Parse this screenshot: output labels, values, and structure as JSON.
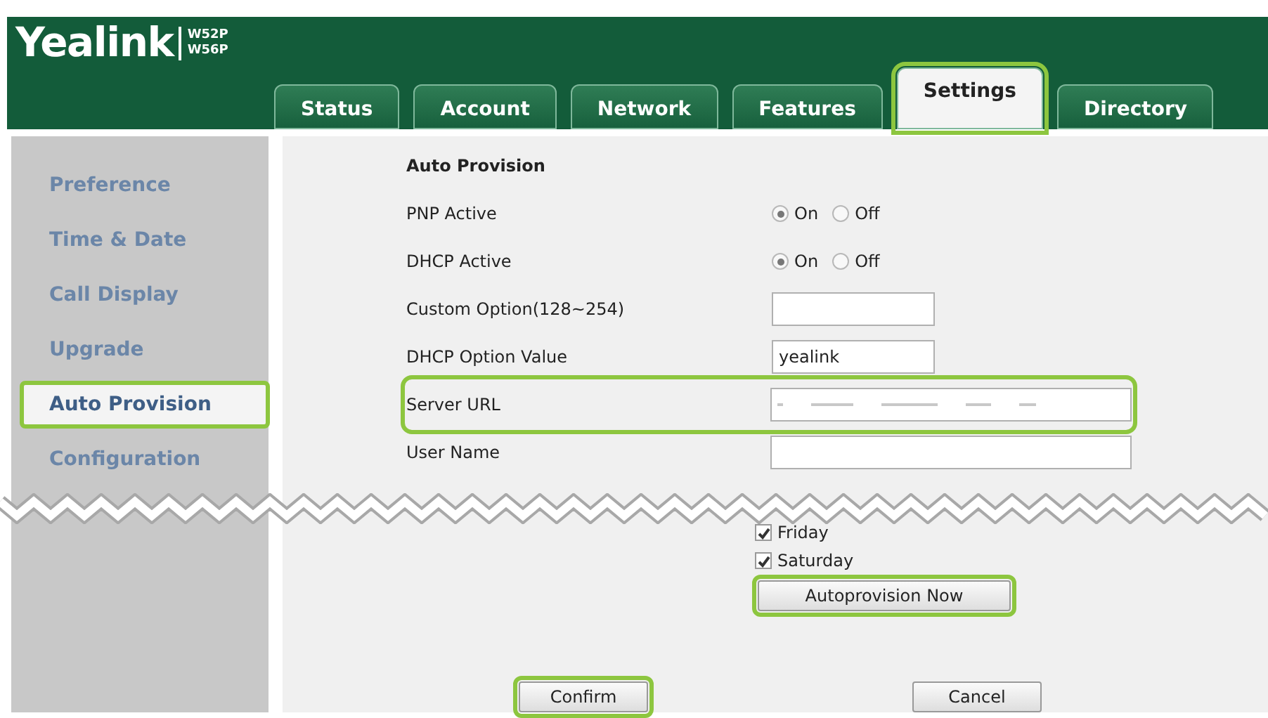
{
  "logo": {
    "brand": "Yealink",
    "models": [
      "W52P",
      "W56P"
    ]
  },
  "tabs": [
    {
      "label": "Status",
      "selected": false,
      "highlighted": false
    },
    {
      "label": "Account",
      "selected": false,
      "highlighted": false
    },
    {
      "label": "Network",
      "selected": false,
      "highlighted": false
    },
    {
      "label": "Features",
      "selected": false,
      "highlighted": false
    },
    {
      "label": "Settings",
      "selected": true,
      "highlighted": true
    },
    {
      "label": "Directory",
      "selected": false,
      "highlighted": false
    }
  ],
  "sidebar": {
    "items": [
      {
        "label": "Preference",
        "selected": false,
        "highlighted": false
      },
      {
        "label": "Time & Date",
        "selected": false,
        "highlighted": false
      },
      {
        "label": "Call Display",
        "selected": false,
        "highlighted": false
      },
      {
        "label": "Upgrade",
        "selected": false,
        "highlighted": false
      },
      {
        "label": "Auto Provision",
        "selected": true,
        "highlighted": true
      },
      {
        "label": "Configuration",
        "selected": false,
        "highlighted": false
      }
    ]
  },
  "section_title": "Auto Provision",
  "rows": [
    {
      "kind": "radio",
      "label": "PNP Active",
      "highlighted": false,
      "options": [
        {
          "label": "On",
          "selected": true
        },
        {
          "label": "Off",
          "selected": false
        }
      ]
    },
    {
      "kind": "radio",
      "label": "DHCP Active",
      "highlighted": false,
      "options": [
        {
          "label": "On",
          "selected": true
        },
        {
          "label": "Off",
          "selected": false
        }
      ]
    },
    {
      "kind": "text",
      "label": "Custom Option(128~254)",
      "highlighted": false
    },
    {
      "kind": "text",
      "label": "DHCP Option Value",
      "highlighted": false,
      "value": "yealink"
    },
    {
      "kind": "redacted",
      "label": "Server URL",
      "highlighted": true
    },
    {
      "kind": "wide_text",
      "label": "User Name",
      "highlighted": false
    }
  ],
  "days": [
    {
      "label": "Friday",
      "checked": true
    },
    {
      "label": "Saturday",
      "checked": true
    }
  ],
  "autoprovision_button": {
    "label": "Autoprovision Now",
    "highlighted": true
  },
  "buttons": [
    {
      "label": "Confirm",
      "highlighted": true
    },
    {
      "label": "Cancel",
      "highlighted": false
    }
  ]
}
